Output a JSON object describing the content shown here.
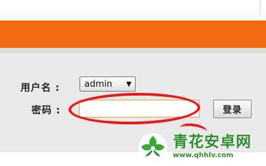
{
  "login_form": {
    "username_label": "用户名 :",
    "username_value": "admin",
    "password_label": "密码 :",
    "password_value": "",
    "submit_label": "登录"
  },
  "watermark": {
    "title": "青花安卓网",
    "url": "www.qhhlv.com"
  },
  "icons": {
    "dropdown": "chevron-down-icon",
    "watermark_logo": "leaf-logo-icon"
  },
  "colors": {
    "header_bar": "#f26a12",
    "highlight_ellipse": "#e51b1b",
    "watermark_green": "#2e8b2e"
  }
}
